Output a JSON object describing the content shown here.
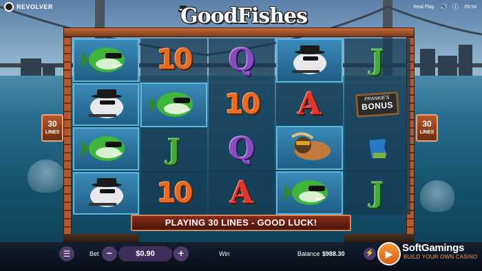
{
  "brand": {
    "name": "REVOLVER"
  },
  "title": "GoodFishes",
  "topbar": {
    "mode": "Real Play",
    "time": "09:54"
  },
  "lines": {
    "left": {
      "count": "30",
      "label": "LINES"
    },
    "right": {
      "count": "30",
      "label": "LINES"
    }
  },
  "reels": [
    [
      {
        "symbol": "fish",
        "highlight": true
      },
      {
        "symbol": "mobster",
        "highlight": true
      },
      {
        "symbol": "fish",
        "highlight": true
      },
      {
        "symbol": "mobster",
        "highlight": true
      }
    ],
    [
      {
        "symbol": "10",
        "highlight": false
      },
      {
        "symbol": "fish",
        "highlight": true
      },
      {
        "symbol": "J",
        "highlight": false
      },
      {
        "symbol": "10",
        "highlight": false
      }
    ],
    [
      {
        "symbol": "Q",
        "highlight": false
      },
      {
        "symbol": "10",
        "highlight": false
      },
      {
        "symbol": "Q",
        "highlight": false
      },
      {
        "symbol": "A",
        "highlight": false
      }
    ],
    [
      {
        "symbol": "mobster",
        "highlight": true
      },
      {
        "symbol": "A",
        "highlight": false
      },
      {
        "symbol": "woman",
        "highlight": true
      },
      {
        "symbol": "fish",
        "highlight": true
      }
    ],
    [
      {
        "symbol": "J",
        "highlight": false
      },
      {
        "symbol": "bonus",
        "highlight": false
      },
      {
        "symbol": "wild",
        "highlight": false
      },
      {
        "symbol": "J",
        "highlight": false
      }
    ]
  ],
  "bonus": {
    "top": "FRANKIE'S",
    "big": "BONUS"
  },
  "message": "PLAYING 30 LINES - GOOD LUCK!",
  "bottombar": {
    "bet_label": "Bet",
    "bet_value": "$0.90",
    "minus": "−",
    "plus": "+",
    "win_label": "Win",
    "balance_label": "Balance",
    "balance_value": "$988.30"
  },
  "watermark": {
    "name": "SoftGamings",
    "tag": "BUILD YOUR OWN CASINO"
  },
  "colors": {
    "accent": "#e86b25",
    "spin": "#f29a3a",
    "frame": "#b55a2c"
  }
}
